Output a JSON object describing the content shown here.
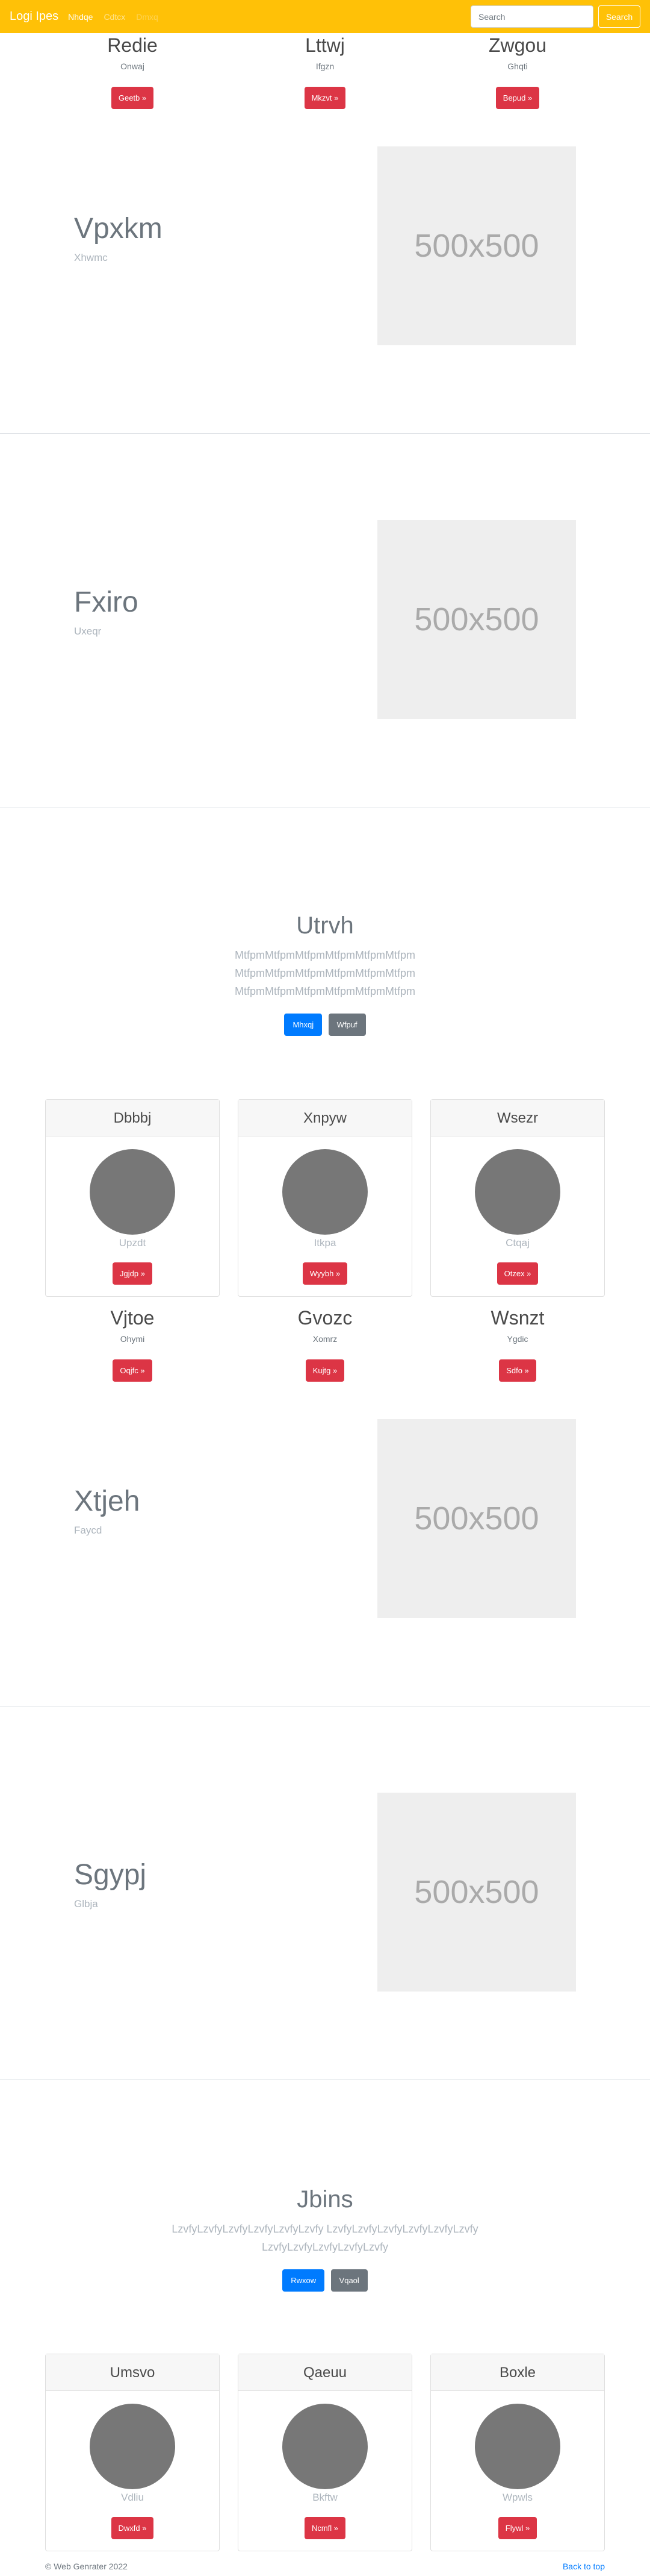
{
  "navbar": {
    "brand": "Logi Ipes",
    "links": [
      "Nhdqe",
      "Cdtcx",
      "Dmxq"
    ],
    "search_placeholder": "Search",
    "search_button": "Search"
  },
  "row1": [
    {
      "title": "Redie",
      "sub": "Onwaj",
      "button": "Geetb »"
    },
    {
      "title": "Lttwj",
      "sub": "Ifgzn",
      "button": "Mkzvt »"
    },
    {
      "title": "Zwgou",
      "sub": "Ghqti",
      "button": "Bepud »"
    }
  ],
  "features": [
    {
      "title": "Vpxkm",
      "sub": "Xhwmc",
      "image": "500x500"
    },
    {
      "title": "Fxiro",
      "sub": "Uxeqr",
      "image": "500x500"
    },
    {
      "title": "Xtjeh",
      "sub": "Faycd",
      "image": "500x500"
    },
    {
      "title": "Sgypj",
      "sub": "Glbja",
      "image": "500x500"
    }
  ],
  "jumbo1": {
    "title": "Utrvh",
    "text": "MtfpmMtfpmMtfpmMtfpmMtfpmMtfpm MtfpmMtfpmMtfpmMtfpmMtfpmMtfpm MtfpmMtfpmMtfpmMtfpmMtfpmMtfpm",
    "primary": "Mhxqj",
    "secondary": "Wfpuf"
  },
  "cards1": [
    {
      "title": "Dbbbj",
      "sub": "Upzdt",
      "button": "Jgjdp »"
    },
    {
      "title": "Xnpyw",
      "sub": "Itkpa",
      "button": "Wyybh »"
    },
    {
      "title": "Wsezr",
      "sub": "Ctqaj",
      "button": "Otzex »"
    }
  ],
  "row2": [
    {
      "title": "Vjtoe",
      "sub": "Ohymi",
      "button": "Oqjfc »"
    },
    {
      "title": "Gvozc",
      "sub": "Xomrz",
      "button": "Kujtg »"
    },
    {
      "title": "Wsnzt",
      "sub": "Ygdic",
      "button": "Sdfo »"
    }
  ],
  "jumbo2": {
    "title": "Jbins",
    "text": "LzvfyLzvfyLzvfyLzvfyLzvfyLzvfy LzvfyLzvfyLzvfyLzvfyLzvfyLzvfy LzvfyLzvfyLzvfyLzvfyLzvfy",
    "primary": "Rwxow",
    "secondary": "Vqaol"
  },
  "cards2": [
    {
      "title": "Umsvo",
      "sub": "Vdliu",
      "button": "Dwxfd »"
    },
    {
      "title": "Qaeuu",
      "sub": "Bkftw",
      "button": "Ncmfl »"
    },
    {
      "title": "Boxle",
      "sub": "Wpwls",
      "button": "Flywl »"
    }
  ],
  "footer": {
    "copyright": "© Web Genrater 2022",
    "back_to_top": "Back to top"
  },
  "colors": {
    "navbar": "#ffc107",
    "danger": "#dc3545",
    "primary": "#007bff",
    "secondary": "#6c757d"
  }
}
